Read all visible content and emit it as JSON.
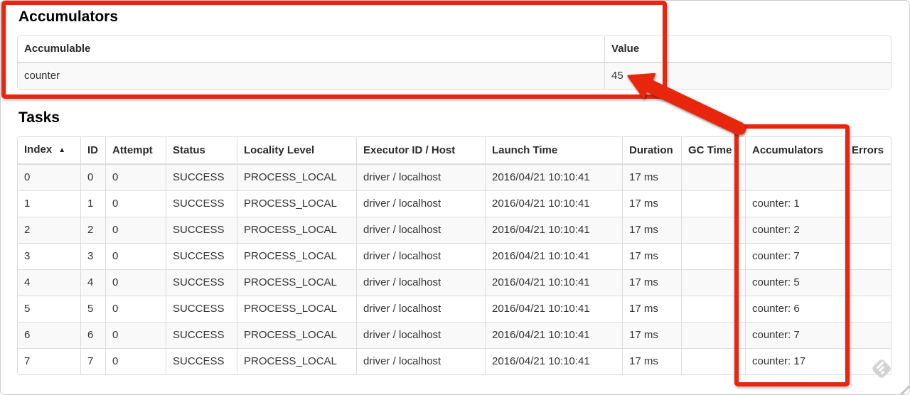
{
  "accumulators_section": {
    "heading": "Accumulators",
    "table": {
      "headers": {
        "accumulable": "Accumulable",
        "value": "Value"
      },
      "row": {
        "accumulable": "counter",
        "value": "45"
      }
    }
  },
  "tasks_section": {
    "heading": "Tasks",
    "table": {
      "sort_indicator": "▲",
      "columns": [
        {
          "key": "index",
          "label": "Index",
          "sorted": true
        },
        {
          "key": "id",
          "label": "ID"
        },
        {
          "key": "attempt",
          "label": "Attempt"
        },
        {
          "key": "status",
          "label": "Status"
        },
        {
          "key": "locality",
          "label": "Locality Level"
        },
        {
          "key": "executor",
          "label": "Executor ID / Host"
        },
        {
          "key": "launch",
          "label": "Launch Time"
        },
        {
          "key": "duration",
          "label": "Duration"
        },
        {
          "key": "gc",
          "label": "GC Time"
        },
        {
          "key": "accumulators",
          "label": "Accumulators"
        },
        {
          "key": "errors",
          "label": "Errors"
        }
      ],
      "rows": [
        {
          "index": "0",
          "id": "0",
          "attempt": "0",
          "status": "SUCCESS",
          "locality": "PROCESS_LOCAL",
          "executor": "driver / localhost",
          "launch": "2016/04/21 10:10:41",
          "duration": "17 ms",
          "gc": "",
          "accumulators": "",
          "errors": ""
        },
        {
          "index": "1",
          "id": "1",
          "attempt": "0",
          "status": "SUCCESS",
          "locality": "PROCESS_LOCAL",
          "executor": "driver / localhost",
          "launch": "2016/04/21 10:10:41",
          "duration": "17 ms",
          "gc": "",
          "accumulators": "counter: 1",
          "errors": ""
        },
        {
          "index": "2",
          "id": "2",
          "attempt": "0",
          "status": "SUCCESS",
          "locality": "PROCESS_LOCAL",
          "executor": "driver / localhost",
          "launch": "2016/04/21 10:10:41",
          "duration": "17 ms",
          "gc": "",
          "accumulators": "counter: 2",
          "errors": ""
        },
        {
          "index": "3",
          "id": "3",
          "attempt": "0",
          "status": "SUCCESS",
          "locality": "PROCESS_LOCAL",
          "executor": "driver / localhost",
          "launch": "2016/04/21 10:10:41",
          "duration": "17 ms",
          "gc": "",
          "accumulators": "counter: 7",
          "errors": ""
        },
        {
          "index": "4",
          "id": "4",
          "attempt": "0",
          "status": "SUCCESS",
          "locality": "PROCESS_LOCAL",
          "executor": "driver / localhost",
          "launch": "2016/04/21 10:10:41",
          "duration": "17 ms",
          "gc": "",
          "accumulators": "counter: 5",
          "errors": ""
        },
        {
          "index": "5",
          "id": "5",
          "attempt": "0",
          "status": "SUCCESS",
          "locality": "PROCESS_LOCAL",
          "executor": "driver / localhost",
          "launch": "2016/04/21 10:10:41",
          "duration": "17 ms",
          "gc": "",
          "accumulators": "counter: 6",
          "errors": ""
        },
        {
          "index": "6",
          "id": "6",
          "attempt": "0",
          "status": "SUCCESS",
          "locality": "PROCESS_LOCAL",
          "executor": "driver / localhost",
          "launch": "2016/04/21 10:10:41",
          "duration": "17 ms",
          "gc": "",
          "accumulators": "counter: 7",
          "errors": ""
        },
        {
          "index": "7",
          "id": "7",
          "attempt": "0",
          "status": "SUCCESS",
          "locality": "PROCESS_LOCAL",
          "executor": "driver / localhost",
          "launch": "2016/04/21 10:10:41",
          "duration": "17 ms",
          "gc": "",
          "accumulators": "counter: 17",
          "errors": ""
        }
      ]
    }
  },
  "annotations": {
    "highlight_color": "#e8250d",
    "watermark_icon": "skitch-diamond"
  }
}
